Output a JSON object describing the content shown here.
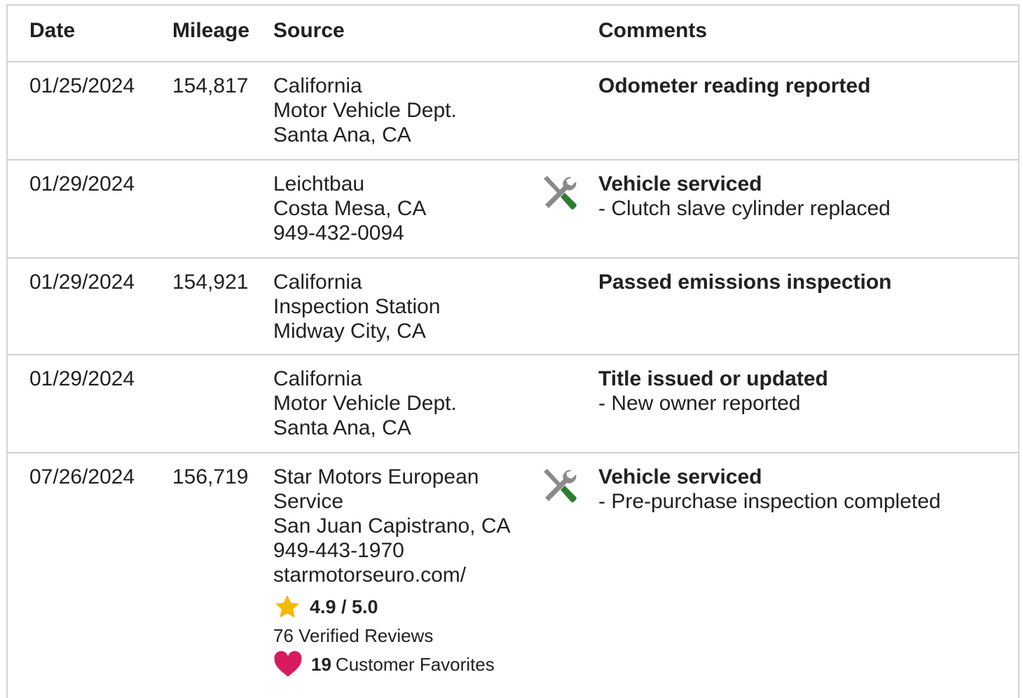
{
  "headers": {
    "date": "Date",
    "mileage": "Mileage",
    "source": "Source",
    "comments": "Comments"
  },
  "rows": [
    {
      "date": "01/25/2024",
      "mileage": "154,817",
      "source": [
        "California",
        "Motor Vehicle Dept.",
        "Santa Ana, CA"
      ],
      "icon": "",
      "title": "Odometer reading reported",
      "detail": ""
    },
    {
      "date": "01/29/2024",
      "mileage": "",
      "source": [
        "Leichtbau",
        "Costa Mesa, CA",
        "949-432-0094"
      ],
      "icon": "wrench-screwdriver-icon",
      "title": "Vehicle serviced",
      "detail": "- Clutch slave cylinder replaced"
    },
    {
      "date": "01/29/2024",
      "mileage": "154,921",
      "source": [
        "California",
        "Inspection Station",
        "Midway City, CA"
      ],
      "icon": "",
      "title": "Passed emissions inspection",
      "detail": ""
    },
    {
      "date": "01/29/2024",
      "mileage": "",
      "source": [
        "California",
        "Motor Vehicle Dept.",
        "Santa Ana, CA"
      ],
      "icon": "",
      "title": "Title issued or updated",
      "detail": "- New owner reported"
    },
    {
      "date": "07/26/2024",
      "mileage": "156,719",
      "source": [
        "Star Motors European",
        "Service",
        "San Juan Capistrano, CA",
        "949-443-1970",
        "starmotorseuro.com/"
      ],
      "icon": "wrench-screwdriver-icon",
      "title": "Vehicle serviced",
      "detail": "- Pre-purchase inspection completed",
      "rating": "4.9 / 5.0",
      "reviews": "76 Verified Reviews",
      "favorites_count": "19",
      "favorites_label": "Customer Favorites"
    }
  ],
  "colors": {
    "star": "#f6b800",
    "heart": "#d81b60",
    "tool_gray": "#8a8a8a",
    "tool_green": "#2e7d32"
  }
}
